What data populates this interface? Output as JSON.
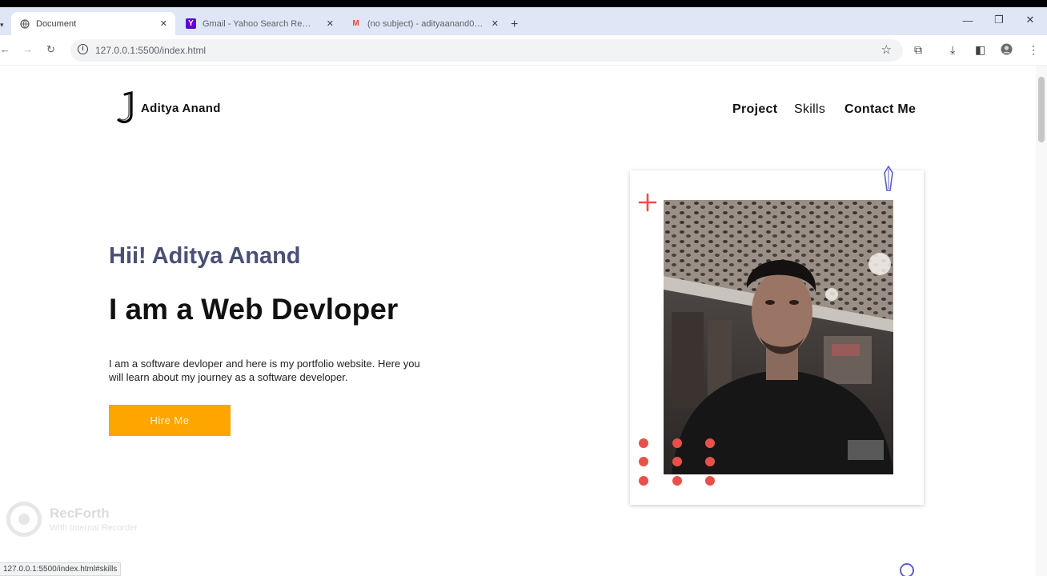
{
  "browser": {
    "tabs": [
      {
        "title": "Document",
        "active": true
      },
      {
        "title": "Gmail - Yahoo Search Results",
        "active": false
      },
      {
        "title": "(no subject) - adityaanand075058...",
        "active": false
      }
    ],
    "url": "127.0.0.1:5500/index.html",
    "status_url": "127.0.0.1:5500/index.html#skills"
  },
  "site": {
    "logo_letter": "J",
    "logo_name": "Aditya Anand",
    "nav": [
      {
        "label": "Project"
      },
      {
        "label": "Skills"
      },
      {
        "label": "Contact Me"
      }
    ],
    "hero": {
      "greeting": "Hii! Aditya Anand",
      "headline": "I am a Web Devloper",
      "description": "I am a software devloper and here is my portfolio website. Here you will learn about my journey as a software developer.",
      "cta": "Hire Me"
    }
  },
  "watermark": {
    "title": "RecForth",
    "subtitle": "With Internal Recorder"
  },
  "colors": {
    "accent": "#ffa500",
    "greeting": "#4a5075",
    "decoration_red": "#e8514a",
    "decoration_blue": "#5b5fc7"
  }
}
